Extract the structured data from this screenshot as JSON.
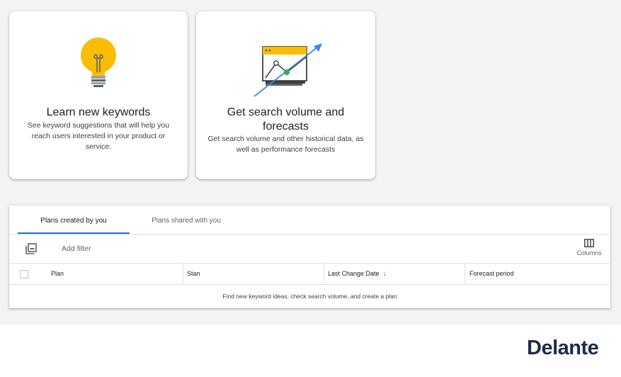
{
  "cards": [
    {
      "title": "Learn new keywords",
      "description": "See keyword suggestions that will help you reach users interested in your product or service.",
      "icon": "lightbulb-icon"
    },
    {
      "title": "Get search volume and forecasts",
      "description": "Get search volume and other historical data, as well as performance forecasts",
      "icon": "forecast-chart-icon"
    }
  ],
  "tabs": [
    {
      "label": "Plans created by you",
      "active": true
    },
    {
      "label": "Plans shared with you",
      "active": false
    }
  ],
  "toolbar": {
    "add_filter_label": "Add filter",
    "columns_label": "Columns",
    "filter_icon": "filter-icon",
    "columns_icon": "columns-icon"
  },
  "table": {
    "columns": [
      "Plan",
      "Stan",
      "Last Change Date",
      "Forecast period"
    ],
    "sort_indicator": "↓",
    "empty_message": "Find new keyword ideas, check search volume, and create a plan"
  },
  "brand": {
    "logo_text": "Delante"
  },
  "colors": {
    "accent_blue": "#1a73e8",
    "bulb_yellow": "#fbbc04",
    "logo_navy": "#1f2a4a",
    "trend_green": "#34a853",
    "trend_blue": "#4285f4"
  }
}
